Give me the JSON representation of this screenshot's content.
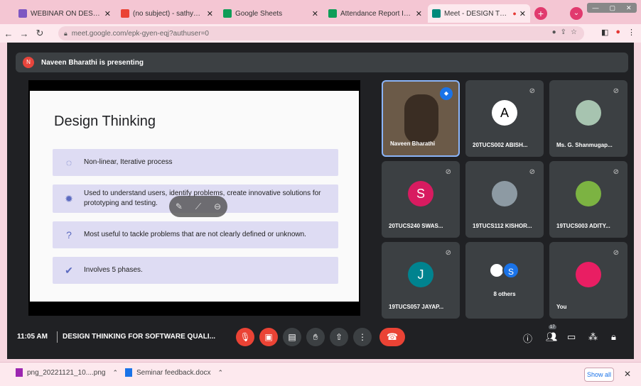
{
  "browser": {
    "tabs": [
      {
        "title": "WEBINAR ON DESIGN THINKING",
        "icon": "form-icon",
        "color": "#7e57c2"
      },
      {
        "title": "(no subject) - sathyabama.s@",
        "icon": "gmail-icon",
        "color": "#ea4335"
      },
      {
        "title": "Google Sheets",
        "icon": "sheets-icon",
        "color": "#0f9d58"
      },
      {
        "title": "Attendance Report Industrial",
        "icon": "sheets-icon",
        "color": "#0f9d58"
      },
      {
        "title": "Meet - DESIGN THINKING",
        "icon": "meet-icon",
        "color": "#00897b"
      }
    ],
    "new_tab": "+",
    "url": "meet.google.com/epk-gyen-eqj?authuser=0"
  },
  "presenting": {
    "initial": "N",
    "text": "Naveen Bharathi is presenting"
  },
  "slide": {
    "title": "Design Thinking",
    "bullets": [
      {
        "icon": "circle-arrows-icon",
        "glyph": "◌",
        "text": "Non-linear, Iterative process"
      },
      {
        "icon": "gear-icon",
        "glyph": "✹",
        "text": "Used to understand users, identify problems, create innovative solutions for prototyping and testing."
      },
      {
        "icon": "question-icon",
        "glyph": "?",
        "text": "Most useful to tackle problems that are not clearly defined or unknown."
      },
      {
        "icon": "check-circle-icon",
        "glyph": "✔",
        "text": "Involves 5 phases."
      }
    ]
  },
  "participants": [
    {
      "name": "Naveen Bharathi",
      "initial": "",
      "color": "#6b5a48"
    },
    {
      "name": "20TUCS002 ABISH...",
      "initial": "A",
      "color": "#ffffff"
    },
    {
      "name": "Ms. G. Shanmugap...",
      "initial": "",
      "color": "#a7c4b0"
    },
    {
      "name": "20TUCS240 SWAS...",
      "initial": "S",
      "color": "#d81b60"
    },
    {
      "name": "19TUCS112 KISHOR...",
      "initial": "",
      "color": "#8d9aa3"
    },
    {
      "name": "19TUCS003 ADITY...",
      "initial": "",
      "color": "#7cb342"
    },
    {
      "name": "19TUCS057 JAYAP...",
      "initial": "J",
      "color": "#00838f"
    },
    {
      "name": "8 others",
      "initial": "S",
      "color": "#1a73e8"
    },
    {
      "name": "You",
      "initial": "",
      "color": "#e91e63"
    }
  ],
  "controls": {
    "time": "11:05 AM",
    "meeting_name": "DESIGN THINKING FOR SOFTWARE QUALI...",
    "people_count": "17"
  },
  "downloads": [
    {
      "name": "png_20221121_10....png"
    },
    {
      "name": "Seminar feedback.docx"
    }
  ],
  "show_all": "Show all"
}
